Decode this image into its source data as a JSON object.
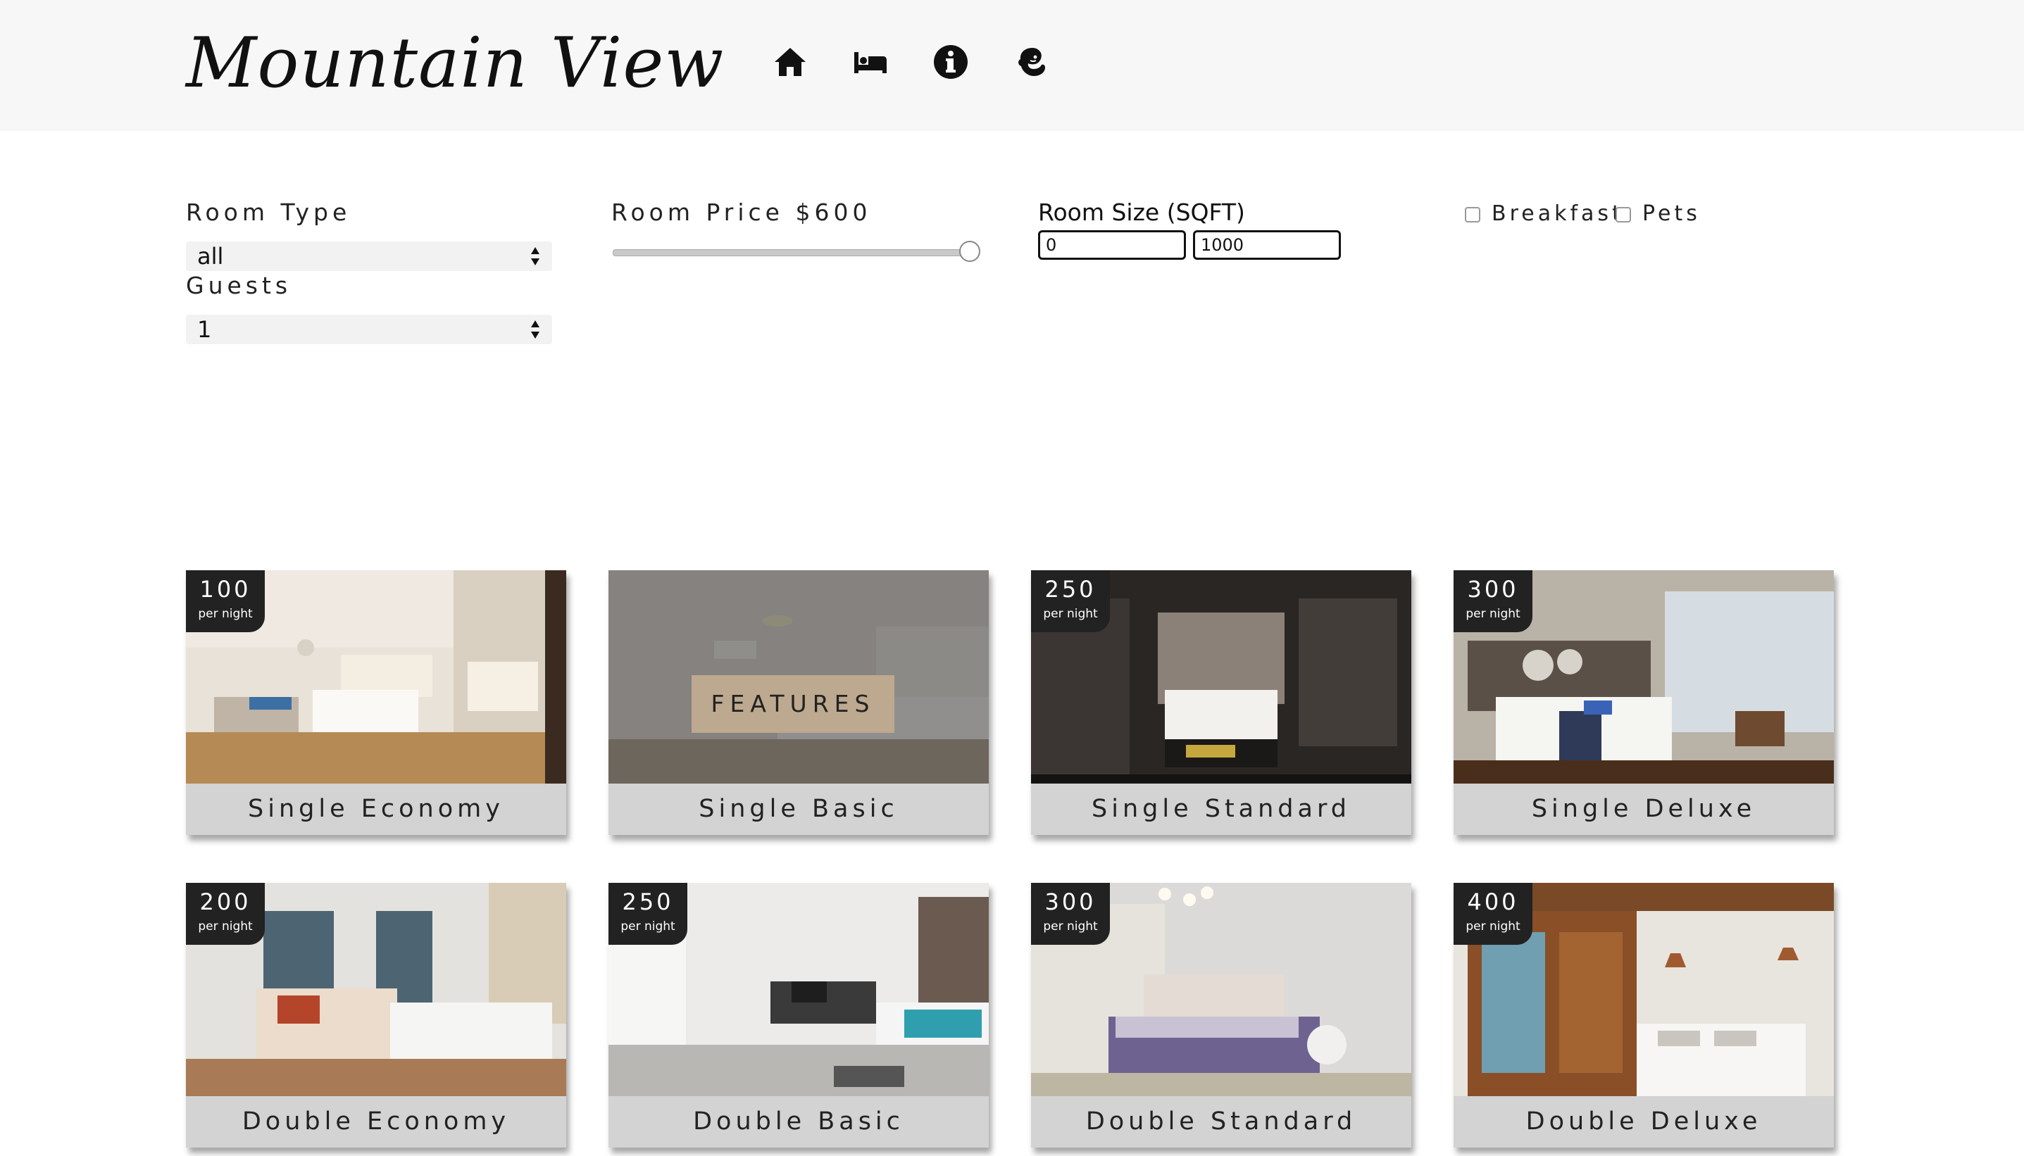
{
  "header": {
    "brand": "Mountain View",
    "nav_icons": [
      "home-icon",
      "bed-icon",
      "info-icon",
      "mailchimp-icon"
    ]
  },
  "filters": {
    "room_type_label": "Room Type",
    "room_type_value": "all",
    "guests_label": "Guests",
    "guests_value": "1",
    "price_label": "Room Price $600",
    "price_value": 600,
    "price_level": 1.0,
    "size_label": "Room Size (SQFT)",
    "size_min": "0",
    "size_max": "1000",
    "breakfast_label": "Breakfast",
    "pets_label": "Pets"
  },
  "rooms": [
    {
      "name": "Single Economy",
      "price": "100",
      "per": "per night"
    },
    {
      "name": "Single Basic",
      "price": "",
      "per": "",
      "hover_label": "FEATURES"
    },
    {
      "name": "Single Standard",
      "price": "250",
      "per": "per night"
    },
    {
      "name": "Single Deluxe",
      "price": "300",
      "per": "per night"
    },
    {
      "name": "Double Economy",
      "price": "200",
      "per": "per night"
    },
    {
      "name": "Double Basic",
      "price": "250",
      "per": "per night"
    },
    {
      "name": "Double Standard",
      "price": "300",
      "per": "per night"
    },
    {
      "name": "Double Deluxe",
      "price": "400",
      "per": "per night"
    }
  ]
}
